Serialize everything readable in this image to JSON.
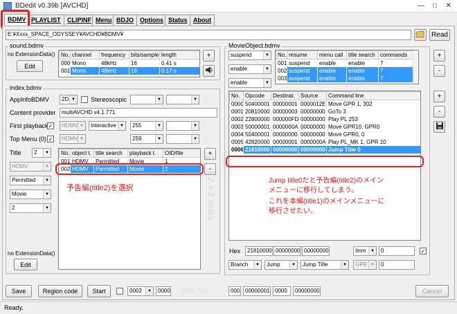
{
  "window": {
    "title": "BDedit v0.39b [AVCHD]"
  },
  "tabs": [
    "BDMV",
    "PLAYLIST",
    "CLIPINF",
    "Menu",
    "BDJO",
    "Options",
    "Status",
    "About"
  ],
  "path": {
    "value": "E:¥Xxxx_SPACE_ODYSSEY¥AVCHD¥BDMV¥",
    "read_label": "Read"
  },
  "sound": {
    "group_label": "sound.bdmv",
    "ext_label": "no ExtensionData()",
    "edit_label": "Edit",
    "columns": [
      "No.",
      "channel",
      "frequency",
      "bits/sample",
      "length"
    ],
    "rows": [
      [
        "000",
        "Mono",
        "48kHz",
        "16",
        "0.41 s"
      ],
      [
        "001",
        "Mono",
        "48kHz",
        "16",
        "0.17 s"
      ]
    ]
  },
  "index": {
    "group_label": "index.bdmv",
    "appinfo_label": "AppInfoBDMV",
    "appinfo_value": "2D",
    "stereo_label": "Stereoscopic",
    "content_provider_label": "Content provider",
    "content_provider_value": "multiAVCHD v4.1.771",
    "first_playback_label": "First playback",
    "top_menu_label": "Top Menu (0)",
    "hdmv": "HDMV",
    "interactive": "Interactive",
    "fp_value": "255",
    "tm_value": "259",
    "title_label": "Title",
    "title_value": "2",
    "left_combo1": "HDMV",
    "left_combo2": "Permitted",
    "left_combo3": "Movie",
    "left_combo4": "2",
    "columns": [
      "No.",
      "object t.",
      "title search",
      "playback t.",
      "OID/file"
    ],
    "rows": [
      [
        "001",
        "HDMV",
        "Permitted",
        "Movie",
        "1"
      ],
      [
        "002",
        "HDMV",
        "Permitted",
        "Movie",
        "2"
      ]
    ],
    "ext_label": "no ExtensionData()",
    "edit_label": "Edit",
    "watermark": "2 + 2 titles"
  },
  "movieobject": {
    "group_label": "MovieObject.bdmv",
    "combos": [
      "suspend",
      "enable",
      "enable"
    ],
    "columns": [
      "No.",
      "resume",
      "menu call",
      "title search",
      "commands"
    ],
    "rows": [
      [
        "001",
        "suspend",
        "enable",
        "enable",
        "7"
      ],
      [
        "002",
        "suspend",
        "enable",
        "enable",
        "7"
      ],
      [
        "003",
        "suspend",
        "enable",
        "enable",
        "7"
      ]
    ],
    "cmd_columns": [
      "No.",
      "Opcode",
      "Destinat.",
      "Source",
      "Command line"
    ],
    "cmd_rows": [
      [
        "0000",
        "50400001",
        "00000001",
        "0000012E",
        "Move GPR 1, 302"
      ],
      [
        "0001",
        "20810000",
        "00000003",
        "00000000",
        "GoTo 3"
      ],
      [
        "0002",
        "22800000",
        "000000FD",
        "00000000",
        "Play PL 253"
      ],
      [
        "0003",
        "50000001",
        "0000000A",
        "00000000",
        "Move GPR10, GPR0"
      ],
      [
        "0004",
        "50400001",
        "00000000",
        "00000000",
        "Move GPR0, 0"
      ],
      [
        "0005",
        "42820000",
        "00000001",
        "0000000A",
        "Play PL_MK 1, GPR 10"
      ],
      [
        "0006",
        "21810000",
        "00000000",
        "00000000",
        "Jump Title 0"
      ]
    ],
    "hex_label": "Hex",
    "hex_values": [
      "21810000",
      "00000000",
      "00000000"
    ],
    "imm": "Imm",
    "imm_value": "0",
    "branch": "Branch",
    "jump": "Jump",
    "jump_title": "Jump Title",
    "gpr": "GPR",
    "gpr_value": "0"
  },
  "annotations": {
    "left": "予告編(title2)を選択",
    "right_lines": [
      "Jump title0だと予告編(title2)のメイン",
      "メニューに移行してしまう。",
      "これを本編(title1)のメインメニューに",
      "移行させたい。"
    ]
  },
  "bottom": {
    "save": "Save",
    "region_code": "Region code",
    "start": "Start",
    "start_combo": "0002",
    "start_field": "0000",
    "f1": "000",
    "f2": "00000001",
    "f3": "0000",
    "f4": "00000000",
    "cancel": "Cancel",
    "watermark": "pel.hu"
  },
  "status": {
    "text": "Ready."
  }
}
